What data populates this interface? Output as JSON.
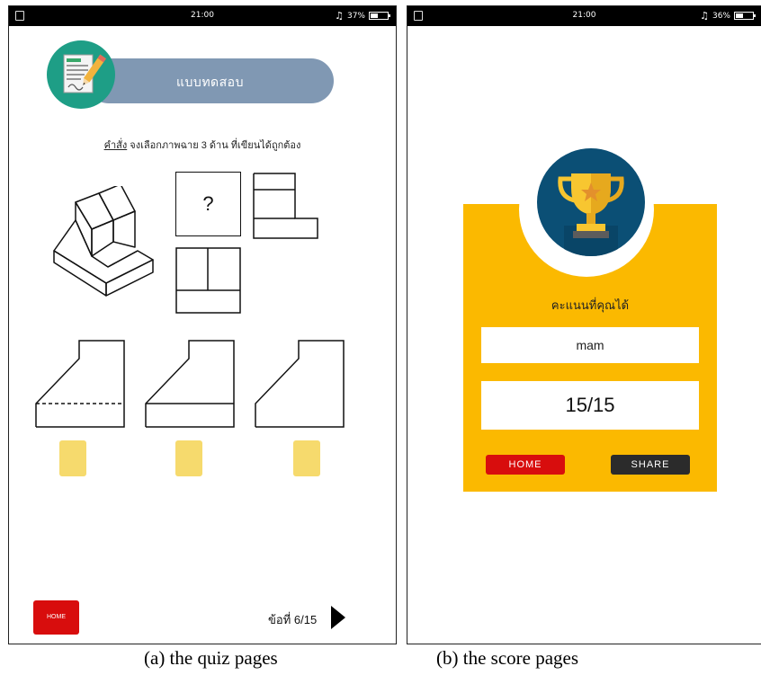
{
  "quiz_page": {
    "status_bar": {
      "time": "21:00",
      "battery": "37%",
      "battery_level": 0.37
    },
    "header": {
      "title": "แบบทดสอบ",
      "icon": "document-pencil-icon"
    },
    "instruction": {
      "keyword": "คำสั่ง",
      "text": " จงเลือกภาพฉาย 3 ด้าน ที่เขียนได้ถูกต้อง"
    },
    "question_mark": "?",
    "choices": [
      "choice-1",
      "choice-2",
      "choice-3"
    ],
    "home_label": "HOME",
    "question_counter": "ข้อที่ 6/15"
  },
  "score_page": {
    "status_bar": {
      "time": "21:00",
      "battery": "36%",
      "battery_level": 0.36
    },
    "score_label": "คะแนนที่คุณได้",
    "player_name": "mam",
    "score": "15/15",
    "home_label": "HOME",
    "share_label": "SHARE"
  },
  "captions": {
    "a": "(a) the quiz pages",
    "b": "(b) the score pages"
  },
  "colors": {
    "header_pill": "#8098b3",
    "avatar_bg": "#1e9e86",
    "choice_card": "#f6da6d",
    "home_red": "#d80d0d",
    "score_panel": "#fbb900",
    "trophy_bg": "#0b4f75",
    "share_dark": "#2b2b2b"
  }
}
